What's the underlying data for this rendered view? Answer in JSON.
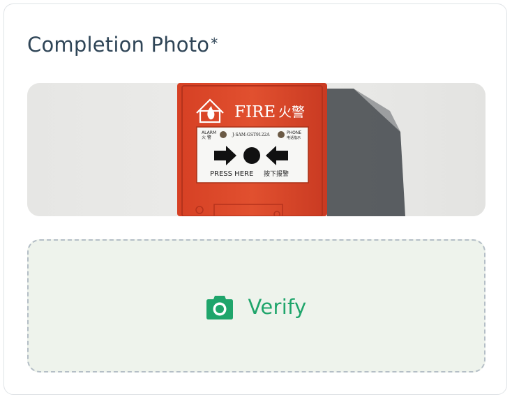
{
  "card": {
    "title": "Completion Photo",
    "required_mark": "*"
  },
  "photo": {
    "panel_brand": "FIRE",
    "panel_brand_cn": "火警",
    "alarm_label": "ALARM",
    "alarm_label_cn": "火 警",
    "model_code": "J-SAM-GST9122A",
    "phone_label": "PHONE",
    "phone_label_cn": "电话指示",
    "press_here": "PRESS  HERE",
    "press_cn": "按下报警"
  },
  "verify": {
    "label": "Verify",
    "icon": "camera-icon"
  },
  "colors": {
    "title": "#2f4557",
    "accent_green": "#1fa56b",
    "drop_zone_bg": "#eef3ec",
    "drop_zone_border": "#b4bec6",
    "alarm_red": "#d9442b"
  }
}
